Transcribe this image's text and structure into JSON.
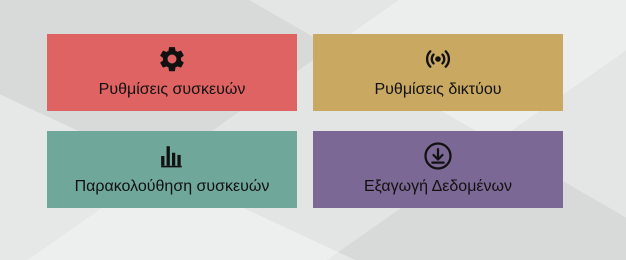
{
  "tiles": [
    {
      "label": "Ρυθμίσεις συσκευών",
      "icon": "gear-icon",
      "color": "#e06363"
    },
    {
      "label": "Ρυθμίσεις δικτύου",
      "icon": "broadcast-icon",
      "color": "#c9a861"
    },
    {
      "label": "Παρακολούθηση συσκευών",
      "icon": "bar-chart-icon",
      "color": "#70a79b"
    },
    {
      "label": "Εξαγωγή Δεδομένων",
      "icon": "download-icon",
      "color": "#7c6894"
    }
  ]
}
